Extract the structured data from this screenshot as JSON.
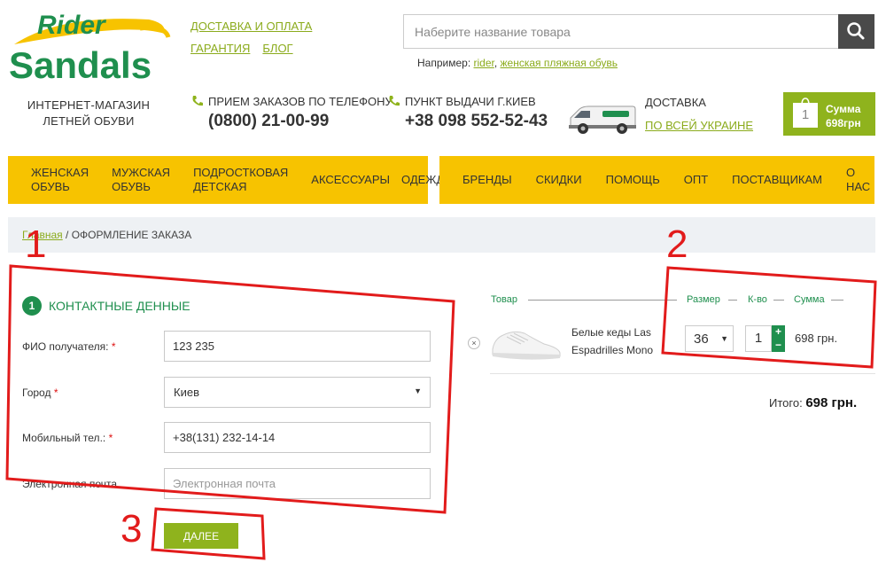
{
  "logo": {
    "line1": "Rider",
    "line2": "Sandals"
  },
  "tagline": [
    "ИНТЕРНЕТ-МАГАЗИН",
    "ЛЕТНЕЙ ОБУВИ"
  ],
  "top_links": {
    "delivery": "ДОСТАВКА И ОПЛАТА",
    "warranty": "ГАРАНТИЯ",
    "blog": "БЛОГ"
  },
  "search": {
    "placeholder": "Наберите название товара",
    "icon": "search-icon"
  },
  "example": {
    "prefix": "Например:",
    "link1": "rider",
    "comma": ",",
    "link2": "женская пляжная обувь"
  },
  "phone_orders": {
    "label": "ПРИЕМ ЗАКАЗОВ ПО ТЕЛЕФОНУ",
    "number": "(0800) 21-00-99"
  },
  "pickup": {
    "label": "ПУНКТ ВЫДАЧИ Г.КИЕВ",
    "number": "+38 098 552-52-43"
  },
  "shipping": {
    "label": "ДОСТАВКА",
    "link": "ПО ВСЕЙ УКРАИНЕ"
  },
  "cart_widget": {
    "count": "1",
    "label": "Сумма",
    "amount": "698грн"
  },
  "nav_left": [
    {
      "line1": "ЖЕНСКАЯ",
      "line2": "ОБУВЬ"
    },
    {
      "line1": "МУЖСКАЯ",
      "line2": "ОБУВЬ"
    },
    {
      "line1": "ПОДРОСТКОВАЯ",
      "line2": "ДЕТСКАЯ"
    },
    {
      "line1": "АКСЕССУАРЫ",
      "line2": ""
    },
    {
      "line1": "ОДЕЖДА",
      "line2": ""
    }
  ],
  "nav_right": [
    "БРЕНДЫ",
    "СКИДКИ",
    "ПОМОЩЬ",
    "ОПТ",
    "ПОСТАВЩИКАМ",
    "О НАС"
  ],
  "breadcrumb": {
    "home": "Главная",
    "separator": " / ",
    "current": "ОФОРМЛЕНИЕ ЗАКАЗА"
  },
  "contact_section": {
    "step": "1",
    "title": "КОНТАКТНЫЕ ДЕННЫЕ",
    "fio": {
      "label": "ФИО получателя:",
      "required": "*",
      "value": "123 235"
    },
    "city": {
      "label": "Город",
      "required": "*",
      "value": "Киев"
    },
    "phone": {
      "label": "Мобильный тел.:",
      "required": "*",
      "value": "+38(131) 232-14-14"
    },
    "email": {
      "label": "Электронная почта",
      "placeholder": "Электронная почта"
    },
    "next_button": "ДАЛЕЕ"
  },
  "order": {
    "headers": {
      "product": "Товар",
      "size": "Размер",
      "qty": "К-во",
      "sum": "Сумма"
    },
    "item": {
      "remove": "×",
      "name_line1": "Белые кеды Las",
      "name_line2": "Espadrilles Mono",
      "size": "36",
      "qty": "1",
      "plus": "+",
      "minus": "−",
      "sum": "698 грн."
    },
    "total_label": "Итого:",
    "total_value": "698 грн."
  },
  "annotations": {
    "n1": "1",
    "n2": "2",
    "n3": "3"
  },
  "colors": {
    "green": "#1f8f4e",
    "lime": "#8fb31d",
    "yellow": "#f7c300",
    "annotation_red": "#e21b1b"
  }
}
